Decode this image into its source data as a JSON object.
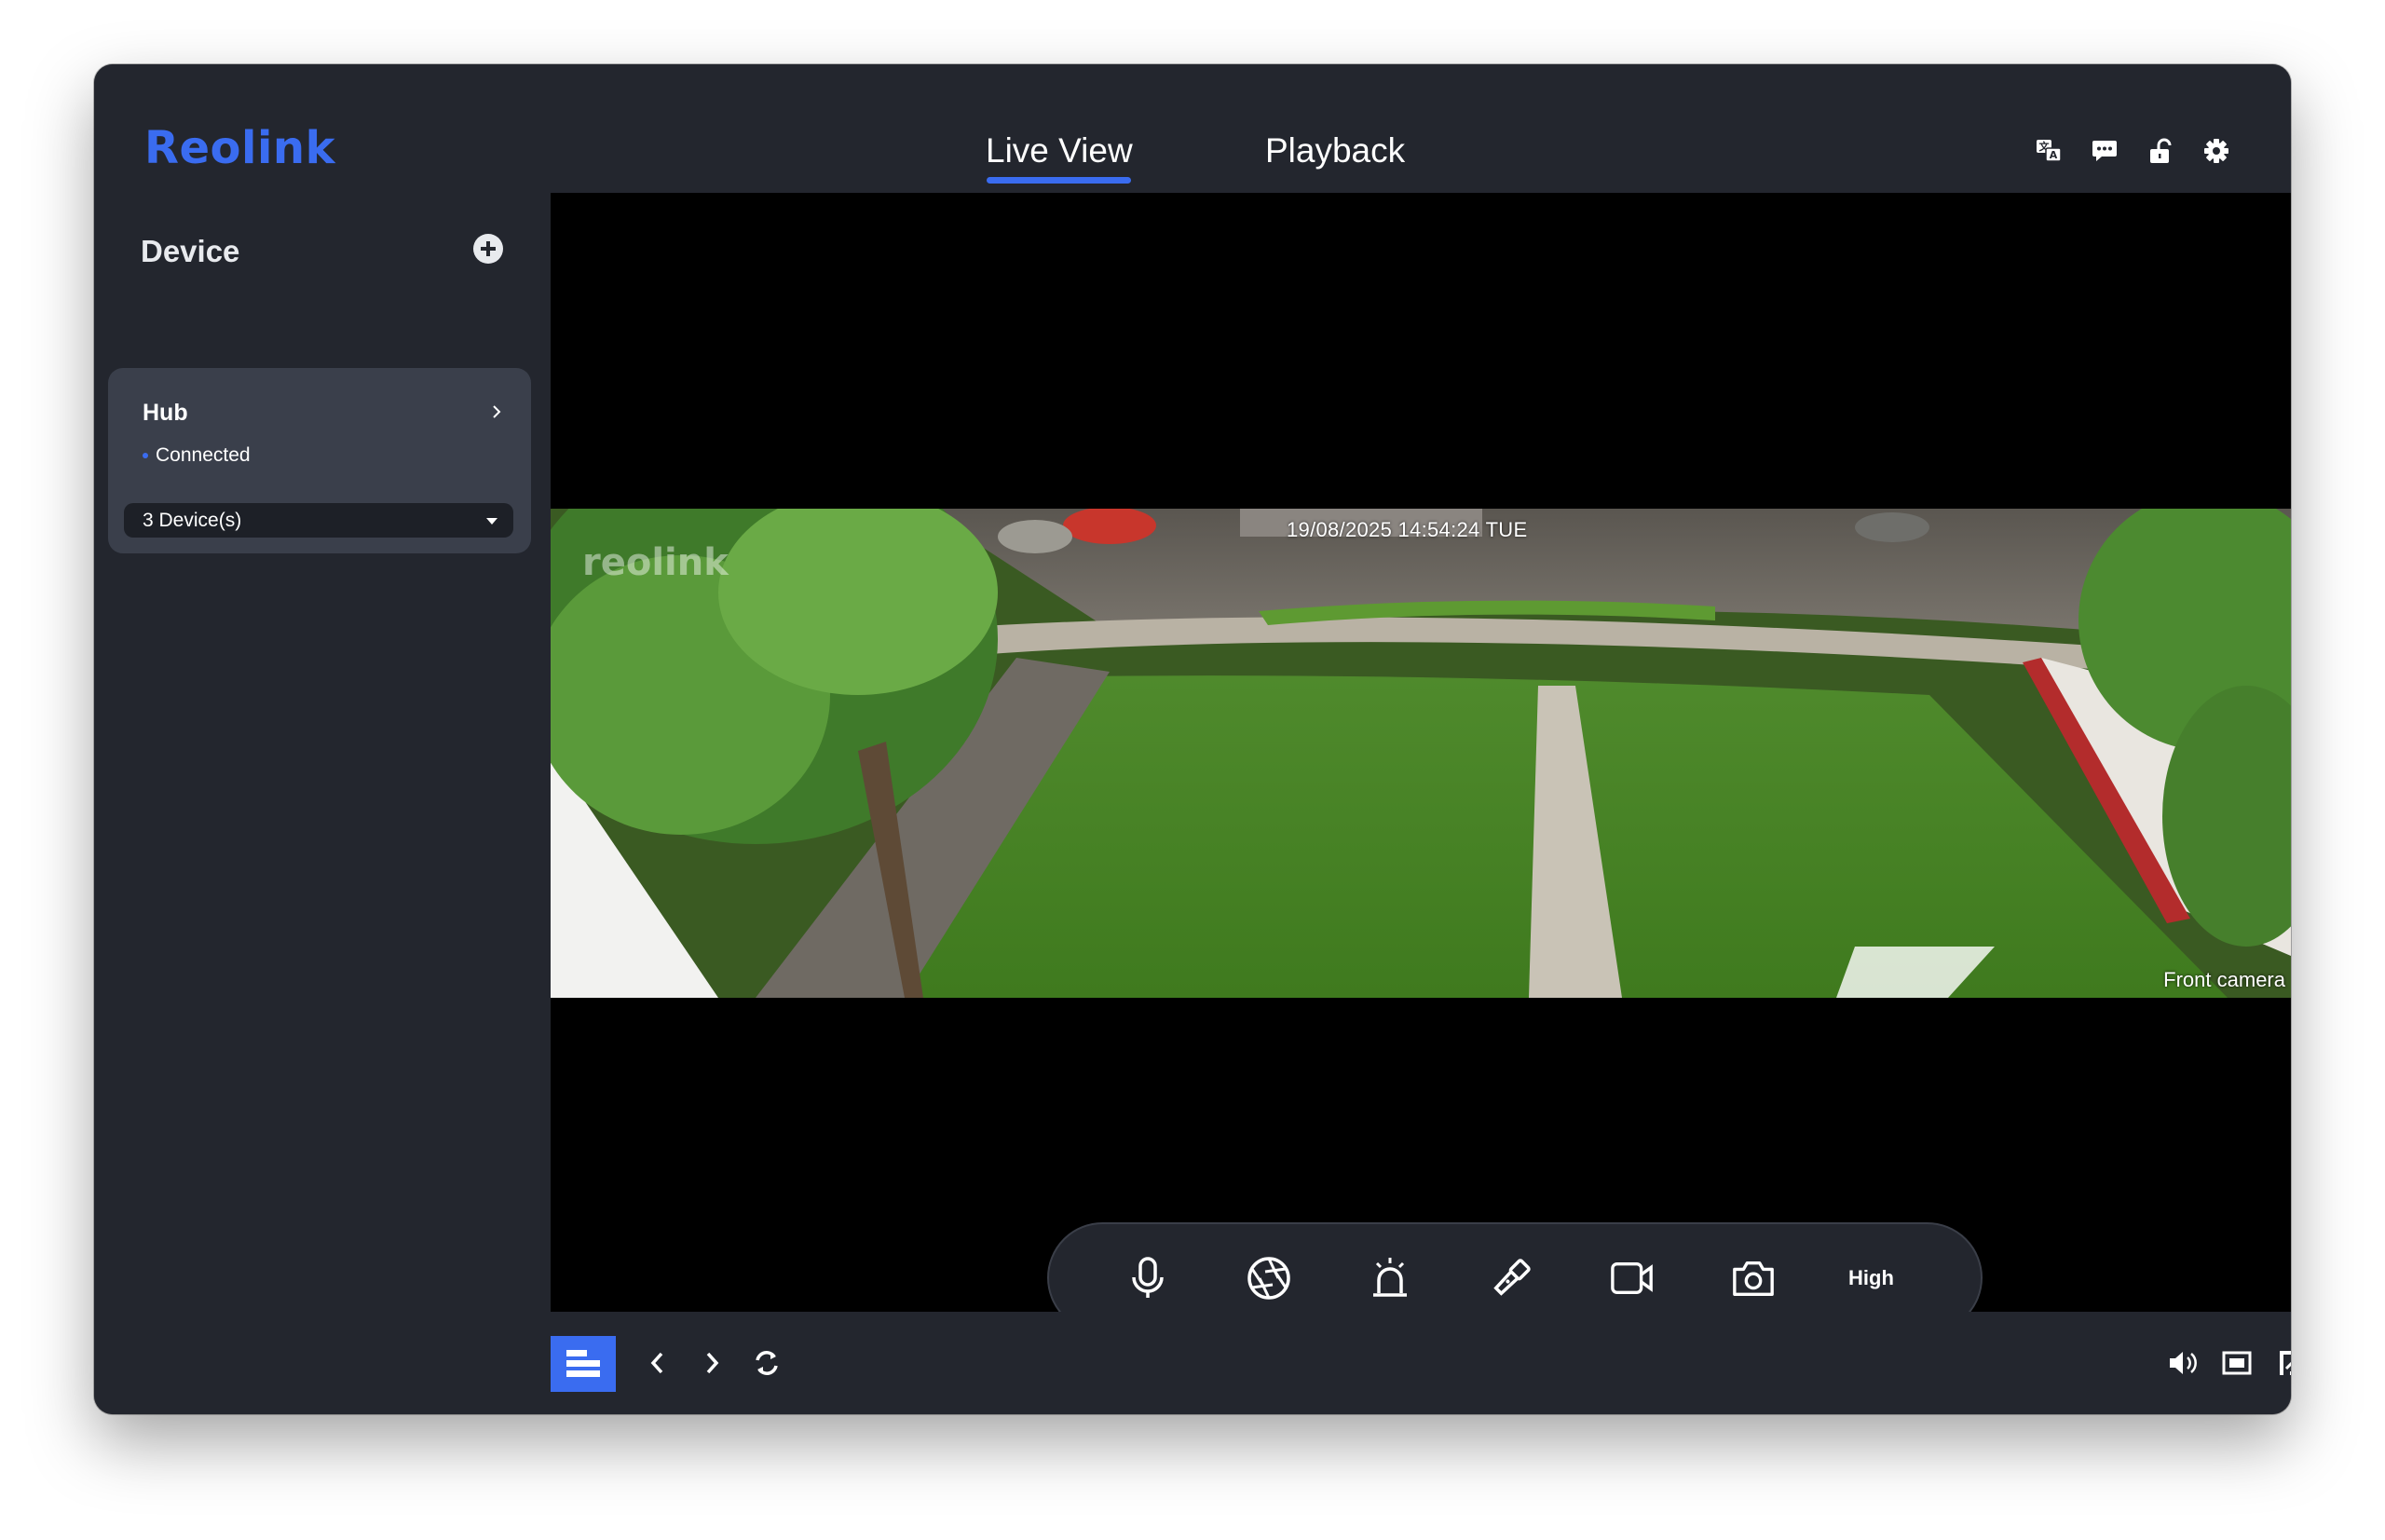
{
  "app": {
    "logo_text": "Reolink",
    "brand_color": "#3a6cf0",
    "background_color": "#23262e"
  },
  "header": {
    "tabs": [
      {
        "label": "Live View",
        "active": true
      },
      {
        "label": "Playback",
        "active": false
      }
    ],
    "icons": [
      "translate-icon",
      "message-icon",
      "unlock-icon",
      "gear-icon"
    ]
  },
  "sidebar": {
    "title": "Device",
    "hub": {
      "name": "Hub",
      "status": "Connected",
      "devices_label": "3 Device(s)"
    }
  },
  "live": {
    "timestamp": "19/08/2025 14:54:24 TUE",
    "watermark": "reolink",
    "camera_name": "Front camera",
    "controls": [
      "microphone-icon",
      "aperture-icon",
      "siren-icon",
      "flashlight-icon",
      "record-icon",
      "snapshot-icon"
    ],
    "quality_label": "High"
  },
  "bottombar": {
    "left_icons": [
      "layout-icon",
      "prev-icon",
      "next-icon",
      "refresh-icon"
    ],
    "right_icons": [
      "volume-icon",
      "aspect-icon",
      "fullscreen-icon"
    ]
  }
}
